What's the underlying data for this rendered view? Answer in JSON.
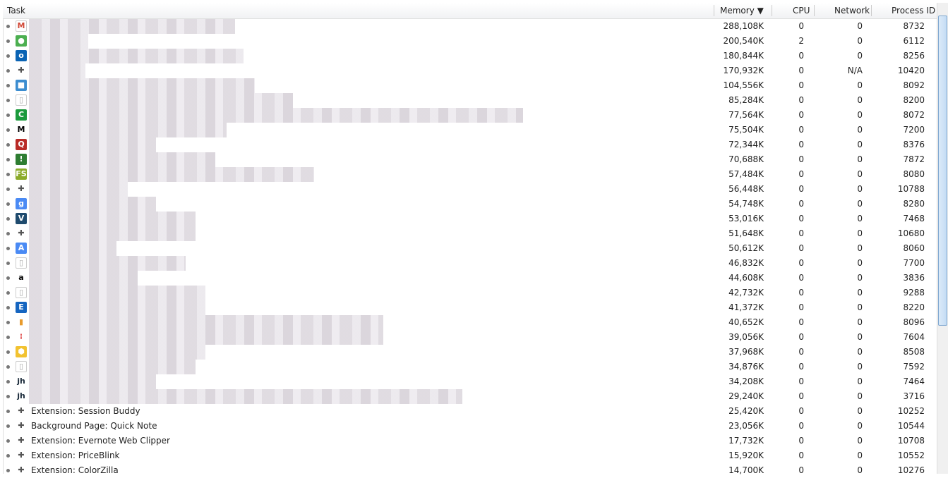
{
  "columns": {
    "task": "Task",
    "memory": "Memory ▼",
    "cpu": "CPU",
    "network": "Network",
    "pid": "Process ID"
  },
  "rows": [
    {
      "icon": "gmail-icon",
      "name": "",
      "memory": "288,108K",
      "cpu": "0",
      "network": "0",
      "pid": "8732"
    },
    {
      "icon": "chrome-icon",
      "name": "",
      "memory": "200,540K",
      "cpu": "2",
      "network": "0",
      "pid": "6112"
    },
    {
      "icon": "outlook-icon",
      "name": "",
      "memory": "180,844K",
      "cpu": "0",
      "network": "0",
      "pid": "8256"
    },
    {
      "icon": "puzzle-icon",
      "name": "",
      "memory": "170,932K",
      "cpu": "0",
      "network": "N/A",
      "pid": "10420"
    },
    {
      "icon": "cube-icon",
      "name": "",
      "memory": "104,556K",
      "cpu": "0",
      "network": "0",
      "pid": "8092"
    },
    {
      "icon": "page-icon",
      "name": "",
      "memory": "85,284K",
      "cpu": "0",
      "network": "0",
      "pid": "8200"
    },
    {
      "icon": "green-c-icon",
      "name": "",
      "memory": "77,564K",
      "cpu": "0",
      "network": "0",
      "pid": "8072"
    },
    {
      "icon": "m-icon",
      "name": "",
      "memory": "75,504K",
      "cpu": "0",
      "network": "0",
      "pid": "7200"
    },
    {
      "icon": "q-icon",
      "name": "",
      "memory": "72,344K",
      "cpu": "0",
      "network": "0",
      "pid": "8376"
    },
    {
      "icon": "exclamation-icon",
      "name": "",
      "memory": "70,688K",
      "cpu": "0",
      "network": "0",
      "pid": "7872"
    },
    {
      "icon": "fs-icon",
      "name": "",
      "memory": "57,484K",
      "cpu": "0",
      "network": "0",
      "pid": "8080"
    },
    {
      "icon": "puzzle-icon",
      "name": "",
      "memory": "56,448K",
      "cpu": "0",
      "network": "0",
      "pid": "10788"
    },
    {
      "icon": "google-icon",
      "name": "",
      "memory": "54,748K",
      "cpu": "0",
      "network": "0",
      "pid": "8280"
    },
    {
      "icon": "v-icon",
      "name": "",
      "memory": "53,016K",
      "cpu": "0",
      "network": "0",
      "pid": "7468"
    },
    {
      "icon": "puzzle-icon",
      "name": "",
      "memory": "51,648K",
      "cpu": "0",
      "network": "0",
      "pid": "10680"
    },
    {
      "icon": "translate-icon",
      "name": "",
      "memory": "50,612K",
      "cpu": "0",
      "network": "0",
      "pid": "8060"
    },
    {
      "icon": "page-icon",
      "name": "",
      "memory": "46,832K",
      "cpu": "0",
      "network": "0",
      "pid": "7700"
    },
    {
      "icon": "amazon-icon",
      "name": "",
      "memory": "44,608K",
      "cpu": "0",
      "network": "0",
      "pid": "3836"
    },
    {
      "icon": "page-icon",
      "name": "",
      "memory": "42,732K",
      "cpu": "0",
      "network": "0",
      "pid": "9288"
    },
    {
      "icon": "e-icon",
      "name": "",
      "memory": "41,372K",
      "cpu": "0",
      "network": "0",
      "pid": "8220"
    },
    {
      "icon": "bar-chart-icon",
      "name": "",
      "memory": "40,652K",
      "cpu": "0",
      "network": "0",
      "pid": "8096"
    },
    {
      "icon": "dots-icon",
      "name": "",
      "memory": "39,056K",
      "cpu": "0",
      "network": "0",
      "pid": "7604"
    },
    {
      "icon": "hexagon-icon",
      "name": "",
      "memory": "37,968K",
      "cpu": "0",
      "network": "0",
      "pid": "8508"
    },
    {
      "icon": "page-icon",
      "name": "",
      "memory": "34,876K",
      "cpu": "0",
      "network": "0",
      "pid": "7592"
    },
    {
      "icon": "jh-icon",
      "name": "",
      "memory": "34,208K",
      "cpu": "0",
      "network": "0",
      "pid": "7464"
    },
    {
      "icon": "jh-icon",
      "name": "",
      "memory": "29,240K",
      "cpu": "0",
      "network": "0",
      "pid": "3716"
    },
    {
      "icon": "puzzle-icon",
      "name": "Extension: Session Buddy",
      "memory": "25,420K",
      "cpu": "0",
      "network": "0",
      "pid": "10252"
    },
    {
      "icon": "puzzle-icon",
      "name": "Background Page: Quick Note",
      "memory": "23,056K",
      "cpu": "0",
      "network": "0",
      "pid": "10544"
    },
    {
      "icon": "puzzle-icon",
      "name": "Extension: Evernote Web Clipper",
      "memory": "17,732K",
      "cpu": "0",
      "network": "0",
      "pid": "10708"
    },
    {
      "icon": "puzzle-icon",
      "name": "Extension: PriceBlink",
      "memory": "15,920K",
      "cpu": "0",
      "network": "0",
      "pid": "10552"
    },
    {
      "icon": "puzzle-icon",
      "name": "Extension: ColorZilla",
      "memory": "14,700K",
      "cpu": "0",
      "network": "0",
      "pid": "10276"
    }
  ]
}
